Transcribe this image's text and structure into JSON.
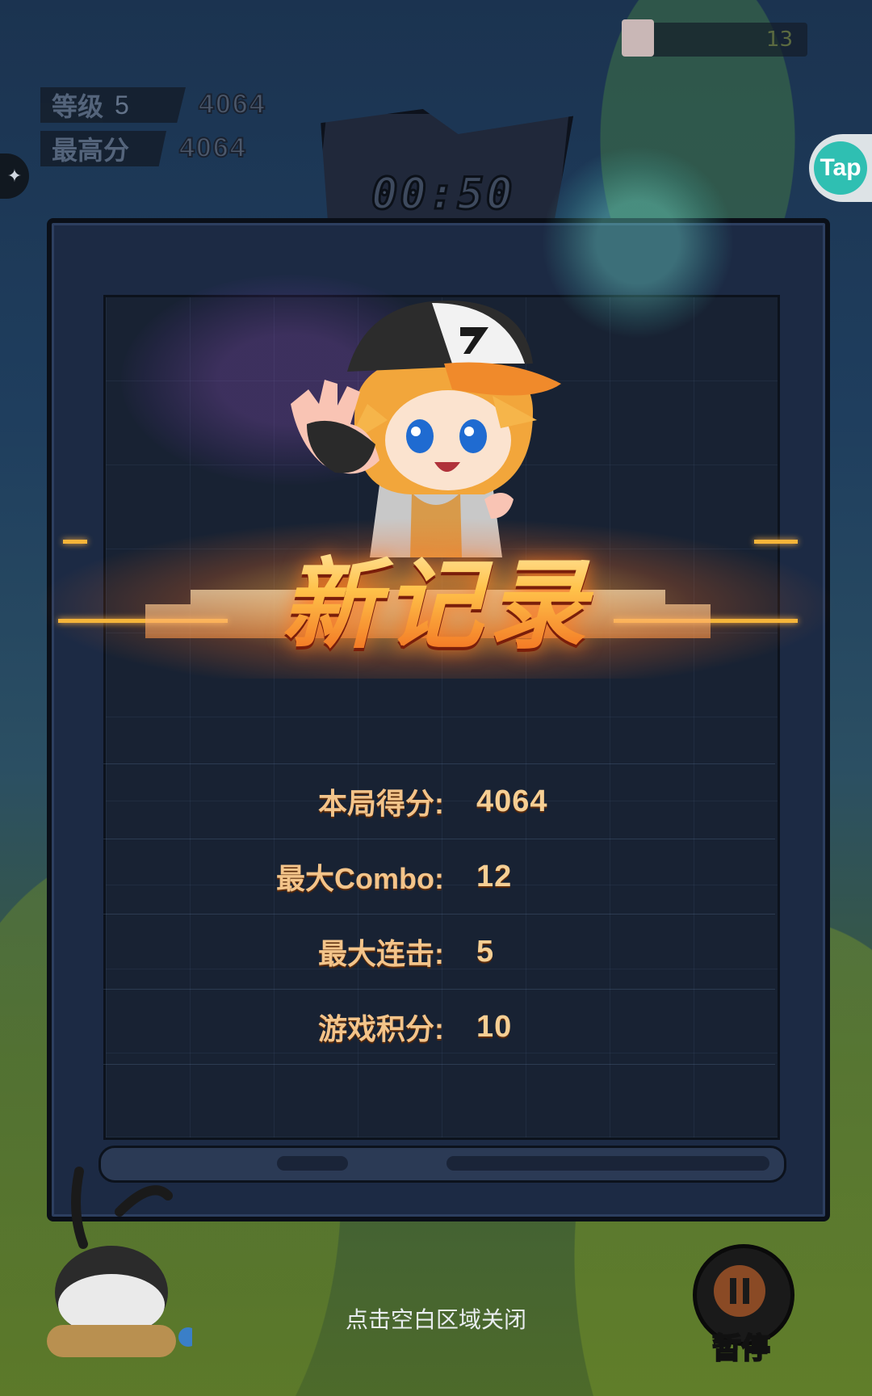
{
  "hud": {
    "level_label": "等级",
    "level_value": "5",
    "level_score": "4064",
    "best_label": "最高分",
    "best_score": "4064"
  },
  "top_right": {
    "count": "13"
  },
  "tap_button": {
    "label": "Tap"
  },
  "timer": {
    "value": "00:50"
  },
  "record": {
    "title": "新记录"
  },
  "stats": [
    {
      "label": "本局得分:",
      "value": "4064"
    },
    {
      "label": "最大Combo:",
      "value": "12"
    },
    {
      "label": "最大连击:",
      "value": "5"
    },
    {
      "label": "游戏积分:",
      "value": "10"
    }
  ],
  "close_hint": "点击空白区域关闭",
  "pause": {
    "label": "暂停"
  },
  "colors": {
    "accent_gold": "#f5b53a",
    "stat_text": "#f3c48a",
    "panel": "#182233",
    "tap_teal": "#2fbfb2"
  },
  "icons": {
    "side_tab": "puzzle-icon",
    "pause": "pause-icon"
  }
}
